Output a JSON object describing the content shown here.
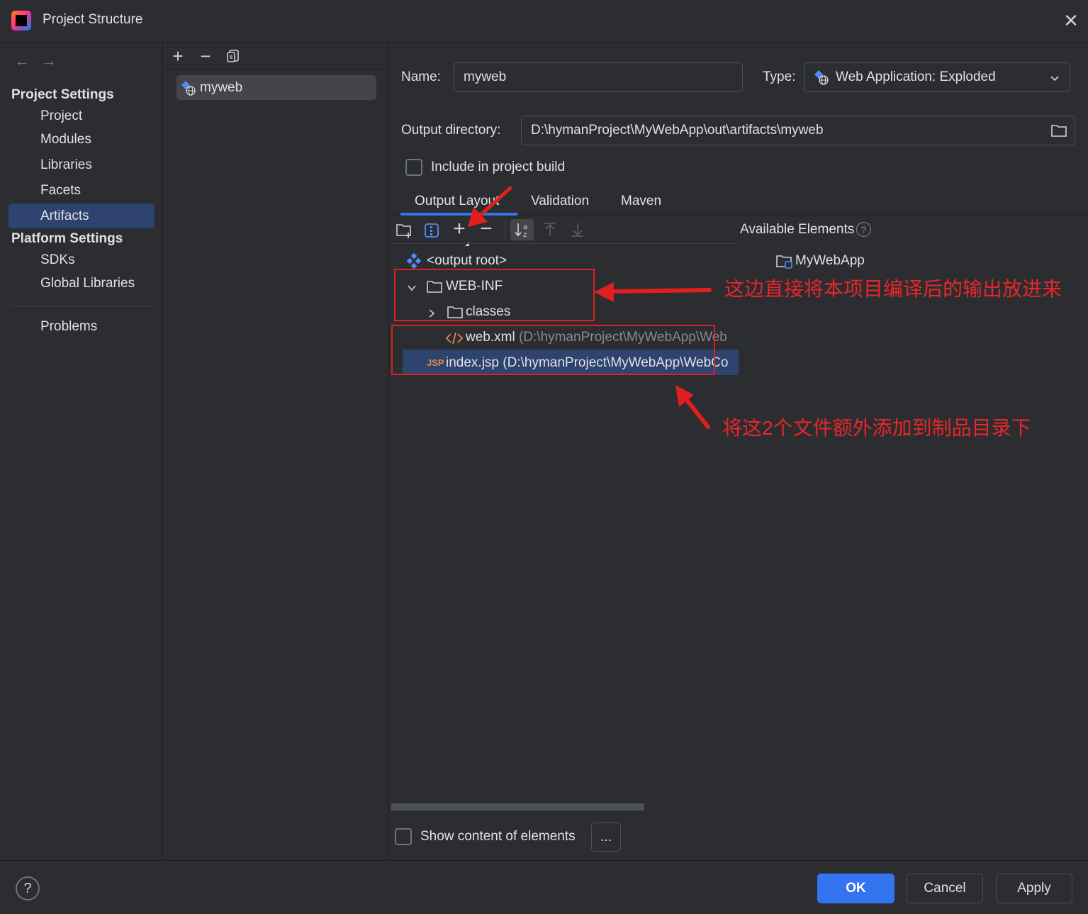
{
  "window": {
    "title": "Project Structure"
  },
  "nav": {
    "project_settings_header": "Project Settings",
    "project_settings": [
      "Project",
      "Modules",
      "Libraries",
      "Facets",
      "Artifacts"
    ],
    "selected": "Artifacts",
    "platform_settings_header": "Platform Settings",
    "platform_settings": [
      "SDKs",
      "Global Libraries"
    ],
    "problems": "Problems"
  },
  "artifacts": {
    "items": [
      "myweb"
    ]
  },
  "form": {
    "name_label": "Name:",
    "name_value": "myweb",
    "type_label": "Type:",
    "type_value": "Web Application: Exploded",
    "output_dir_label": "Output directory:",
    "output_dir_value": "D:\\hymanProject\\MyWebApp\\out\\artifacts\\myweb",
    "include_build_label": "Include in project build",
    "include_build_checked": false
  },
  "tabs": [
    "Output Layout",
    "Validation",
    "Maven"
  ],
  "active_tab": "Output Layout",
  "layout_tree": {
    "root": "<output root>",
    "web_inf": "WEB-INF",
    "classes": "classes",
    "web_xml_name": "web.xml",
    "web_xml_path": "(D:\\hymanProject\\MyWebApp\\Web",
    "index_jsp": "index.jsp (D:\\hymanProject\\MyWebApp\\WebCo",
    "jsp_badge": "JSP"
  },
  "available": {
    "header": "Available Elements",
    "help": "?",
    "items": [
      "MyWebApp"
    ]
  },
  "show_content_label": "Show content of elements",
  "show_content_checked": false,
  "ellipsis_button": "...",
  "buttons": {
    "ok": "OK",
    "cancel": "Cancel",
    "apply": "Apply"
  },
  "help_icon": "?",
  "annotations": {
    "top": "这边直接将本项目编译后的输出放进来",
    "bottom": "将这2个文件额外添加到制品目录下"
  },
  "colors": {
    "accent": "#3574f0",
    "annotation_red": "#e02020",
    "selection": "#2e436e"
  }
}
